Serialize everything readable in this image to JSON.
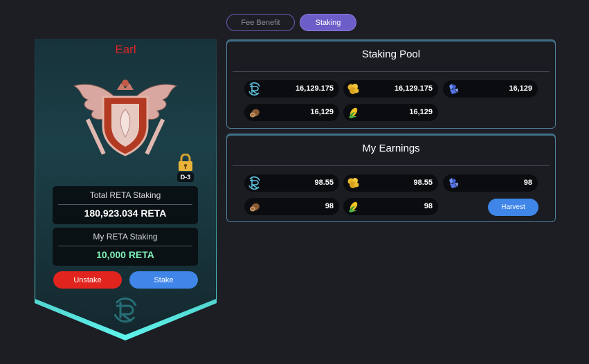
{
  "tabs": [
    {
      "label": "Fee Benefit",
      "active": false
    },
    {
      "label": "Staking",
      "active": true
    }
  ],
  "profile": {
    "name": "Earl",
    "rank_label": "D-3",
    "total_label": "Total RETA Staking",
    "total_value": "180,923.034 RETA",
    "my_label": "My RETA Staking",
    "my_value": "10,000 RETA",
    "unstake_label": "Unstake",
    "stake_label": "Stake"
  },
  "pool": {
    "title": "Staking Pool",
    "items": [
      {
        "icon": "reta-token-icon",
        "value": "16,129.175"
      },
      {
        "icon": "gold-ore-icon",
        "value": "16,129.175"
      },
      {
        "icon": "blue-crystal-icon",
        "value": "16,129"
      },
      {
        "icon": "wood-log-icon",
        "value": "16,129"
      },
      {
        "icon": "corn-icon",
        "value": "16,129"
      }
    ]
  },
  "earnings": {
    "title": "My Earnings",
    "items": [
      {
        "icon": "reta-token-icon",
        "value": "98.55"
      },
      {
        "icon": "gold-ore-icon",
        "value": "98.55"
      },
      {
        "icon": "blue-crystal-icon",
        "value": "98"
      },
      {
        "icon": "wood-log-icon",
        "value": "98"
      },
      {
        "icon": "corn-icon",
        "value": "98"
      }
    ],
    "harvest_label": "Harvest"
  },
  "colors": {
    "accent": "#6c5ec8",
    "name_red": "#e02424",
    "stake_blue": "#3f86e8",
    "unstake_red": "#e1251e",
    "green_value": "#7ff0b8"
  }
}
